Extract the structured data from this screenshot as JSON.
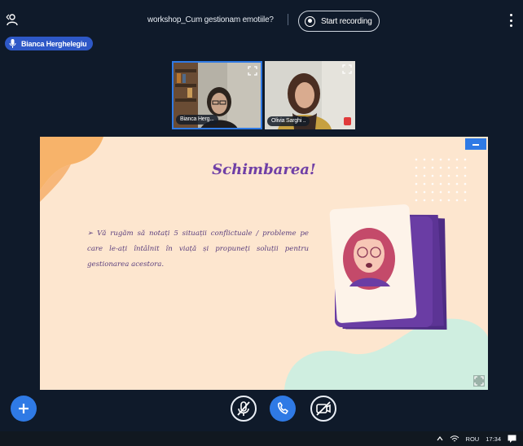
{
  "header": {
    "meeting_title": "workshop_Cum gestionam emotiile?",
    "record_label": "Start recording"
  },
  "presenter": {
    "name": "Bianca Herghelegiu"
  },
  "videos": [
    {
      "name": "Bianca Herg...",
      "active": true
    },
    {
      "name": "Olivia Sarghi ..",
      "muted": true
    }
  ],
  "slide": {
    "title": "Schimbarea!",
    "bullet": "➢ Vă rugăm să notați 5 situații conflictuale / probleme pe care le-ați întâlnit în viață și propuneți soluții pentru gestionarea acestora."
  },
  "controls": {
    "add": "plus-icon",
    "mic": "mic-off-icon",
    "phone": "phone-icon",
    "camera": "camera-off-icon"
  },
  "taskbar": {
    "language": "ROU",
    "time": "17:34"
  },
  "colors": {
    "background": "#0f1a2a",
    "accent": "#2f7ae5",
    "slide_bg": "#fde6cf",
    "slide_title": "#6f3fa6",
    "card_purple": "#6a3da4"
  }
}
